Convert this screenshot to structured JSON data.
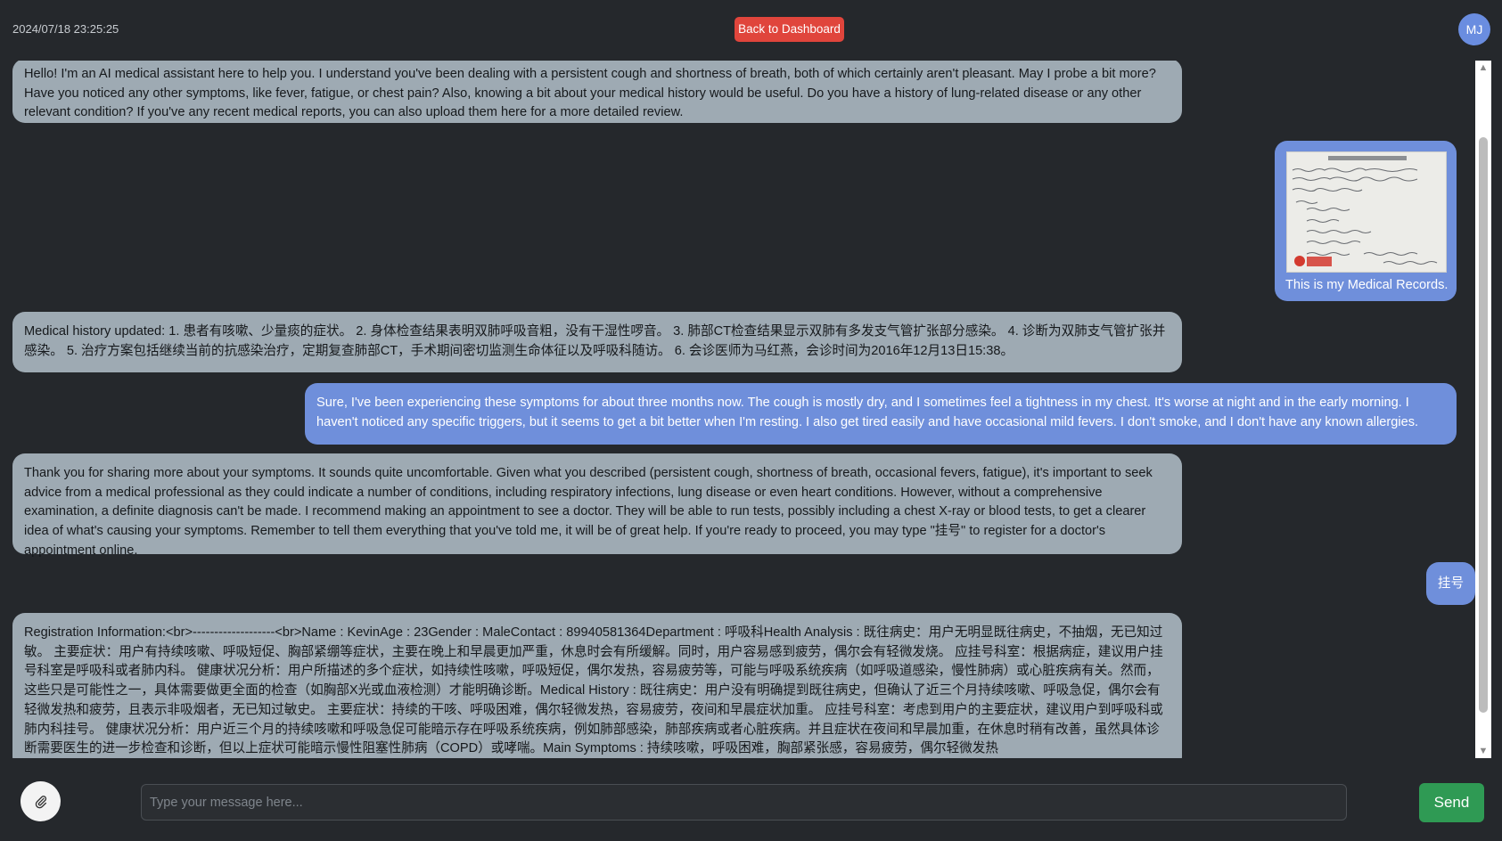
{
  "header": {
    "timestamp": "2024/07/18 23:25:25",
    "back_button_label": "Back to Dashboard",
    "avatar_initials": "MJ"
  },
  "messages": [
    {
      "role": "assistant",
      "text": "Hello! I'm an AI medical assistant here to help you. I understand you've been dealing with a persistent cough and shortness of breath, both of which certainly aren't pleasant. May I probe a bit more? Have you noticed any other symptoms, like fever, fatigue, or chest pain? Also, knowing a bit about your medical history would be useful. Do you have a history of lung-related disease or any other relevant condition? If you've any recent medical reports, you can also upload them here for a more detailed review."
    },
    {
      "role": "user",
      "attachment": "medical-record-image",
      "text": "This is my Medical Records."
    },
    {
      "role": "assistant",
      "text": "Medical history updated: 1. 患者有咳嗽、少量痰的症状。 2. 身体检查结果表明双肺呼吸音粗，没有干湿性啰音。 3. 肺部CT检查结果显示双肺有多发支气管扩张部分感染。 4. 诊断为双肺支气管扩张并感染。 5. 治疗方案包括继续当前的抗感染治疗，定期复查肺部CT，手术期间密切监测生命体征以及呼吸科随访。 6. 会诊医师为马红燕，会诊时间为2016年12月13日15:38。"
    },
    {
      "role": "user",
      "text": "Sure, I've been experiencing these symptoms for about three months now. The cough is mostly dry, and I sometimes feel a tightness in my chest. It's worse at night and in the early morning. I haven't noticed any specific triggers, but it seems to get a bit better when I'm resting. I also get tired easily and have occasional mild fevers. I don't smoke, and I don't have any known allergies."
    },
    {
      "role": "assistant",
      "text": "Thank you for sharing more about your symptoms. It sounds quite uncomfortable. Given what you described (persistent cough, shortness of breath, occasional fevers, fatigue), it's important to seek advice from a medical professional as they could indicate a number of conditions, including respiratory infections, lung disease or even heart conditions. However, without a comprehensive examination, a definite diagnosis can't be made. I recommend making an appointment to see a doctor. They will be able to run tests, possibly including a chest X-ray or blood tests, to get a clearer idea of what's causing your symptoms. Remember to tell them everything that you've told me, it will be of great help. If you're ready to proceed, you may type \"挂号\" to register for a doctor's appointment online."
    },
    {
      "role": "user",
      "text": "挂号"
    },
    {
      "role": "assistant",
      "text": "Registration Information:<br>-------------------<br>Name : KevinAge : 23Gender : MaleContact : 89940581364Department : 呼吸科Health Analysis : 既往病史：用户无明显既往病史，不抽烟，无已知过敏。 主要症状：用户有持续咳嗽、呼吸短促、胸部紧绷等症状，主要在晚上和早晨更加严重，休息时会有所缓解。同时，用户容易感到疲劳，偶尔会有轻微发烧。 应挂号科室：根据病症，建议用户挂号科室是呼吸科或者肺内科。 健康状况分析：用户所描述的多个症状，如持续性咳嗽，呼吸短促，偶尔发热，容易疲劳等，可能与呼吸系统疾病（如呼吸道感染，慢性肺病）或心脏疾病有关。然而，这些只是可能性之一，具体需要做更全面的检查（如胸部X光或血液检测）才能明确诊断。Medical History : 既往病史：用户没有明确提到既往病史，但确认了近三个月持续咳嗽、呼吸急促，偶尔会有轻微发热和疲劳，且表示非吸烟者，无已知过敏史。 主要症状：持续的干咳、呼吸困难，偶尔轻微发热，容易疲劳，夜间和早晨症状加重。 应挂号科室：考虑到用户的主要症状，建议用户到呼吸科或肺内科挂号。 健康状况分析：用户近三个月的持续咳嗽和呼吸急促可能暗示存在呼吸系统疾病，例如肺部感染，肺部疾病或者心脏疾病。并且症状在夜间和早晨加重，在休息时稍有改善，虽然具体诊断需要医生的进一步检查和诊断，但以上症状可能暗示慢性阻塞性肺病（COPD）或哮喘。Main Symptoms : 持续咳嗽，呼吸困难，胸部紧张感，容易疲劳，偶尔轻微发热"
    }
  ],
  "input": {
    "placeholder": "Type your message here...",
    "value": ""
  },
  "send_button_label": "Send",
  "colors": {
    "background": "#25282c",
    "assistant_bubble": "#9eaab3",
    "user_bubble": "#6f8fdb",
    "back_button": "#e0453c",
    "send_button": "#2f9a54",
    "avatar": "#6a8de0"
  },
  "icons": {
    "attach": "paperclip-icon",
    "scroll_up": "triangle-up-icon",
    "scroll_down": "triangle-down-icon"
  }
}
